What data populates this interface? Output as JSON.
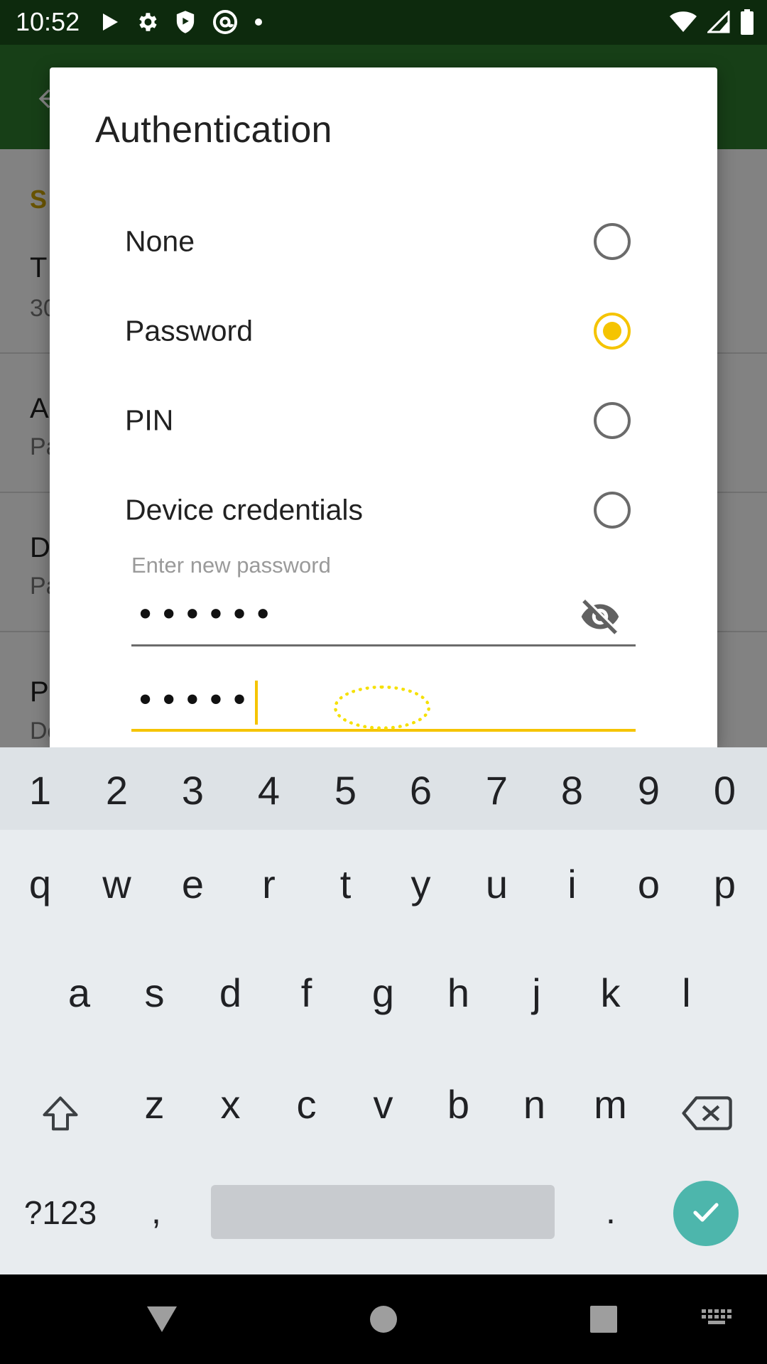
{
  "status_bar": {
    "time": "10:52",
    "left_icons": [
      "play-icon",
      "gear-icon",
      "shield-icon",
      "at-sign-icon",
      "dot-icon"
    ],
    "right_icons": [
      "wifi-icon",
      "signal-icon",
      "battery-icon"
    ]
  },
  "background": {
    "section_header": "S",
    "items": [
      {
        "title": "T",
        "subtitle": "30"
      },
      {
        "title": "A",
        "subtitle": "Pa"
      },
      {
        "title": "D",
        "subtitle": "Pa"
      },
      {
        "title": "P",
        "subtitle": "De"
      }
    ]
  },
  "dialog": {
    "title": "Authentication",
    "options": [
      {
        "label": "None",
        "checked": false
      },
      {
        "label": "Password",
        "checked": true
      },
      {
        "label": "PIN",
        "checked": false
      },
      {
        "label": "Device credentials",
        "checked": false
      }
    ],
    "password_hint": "Enter new password",
    "password_value": "••••••",
    "confirm_value": "•••••",
    "eye_icon": "eye-off-icon"
  },
  "keyboard": {
    "numbers": [
      "1",
      "2",
      "3",
      "4",
      "5",
      "6",
      "7",
      "8",
      "9",
      "0"
    ],
    "row1": [
      "q",
      "w",
      "e",
      "r",
      "t",
      "y",
      "u",
      "i",
      "o",
      "p"
    ],
    "row2": [
      "a",
      "s",
      "d",
      "f",
      "g",
      "h",
      "j",
      "k",
      "l"
    ],
    "row3": [
      "z",
      "x",
      "c",
      "v",
      "b",
      "n",
      "m"
    ],
    "symbols_label": "?123",
    "comma": ",",
    "period": ".",
    "shift_icon": "shift-icon",
    "backspace_icon": "backspace-icon",
    "enter_icon": "check-icon",
    "accent_color": "#4db6ac"
  },
  "nav_bar": {
    "buttons": [
      "back-triangle-icon",
      "home-circle-icon",
      "recents-square-icon",
      "keyboard-switch-icon"
    ]
  },
  "colors": {
    "accent": "#f5c400",
    "toolbar": "#2c7a2c",
    "status_bar": "#0d2a0d"
  }
}
